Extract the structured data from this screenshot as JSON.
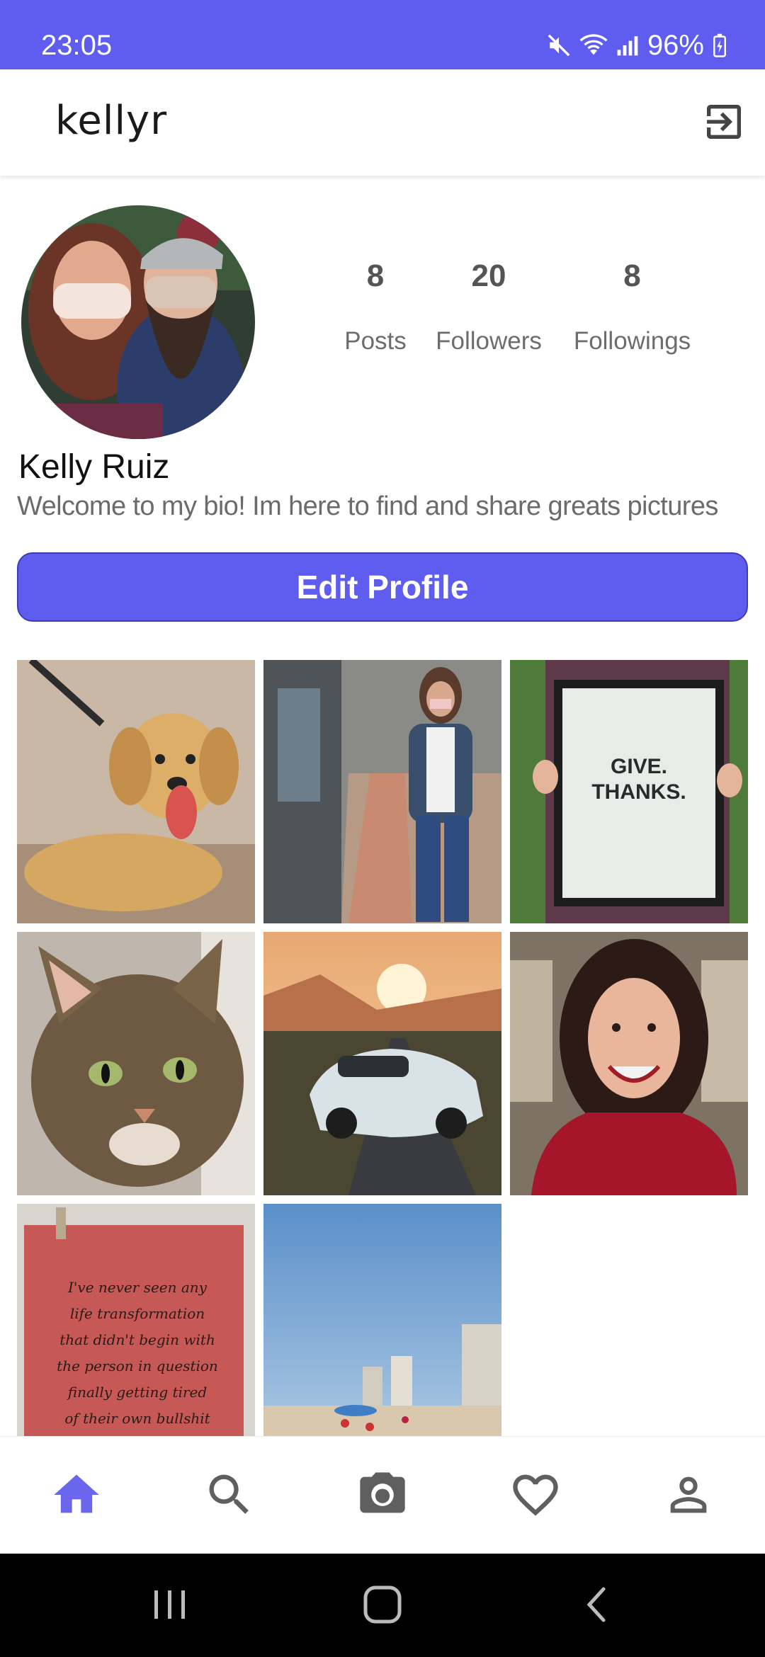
{
  "status_bar": {
    "time": "23:05",
    "battery": "96%",
    "icons": [
      "mute-icon",
      "wifi-icon",
      "signal-icon",
      "battery-charging-icon"
    ]
  },
  "app_bar": {
    "title": "kellyr",
    "logout_icon": "logout-icon"
  },
  "profile": {
    "name": "Kelly Ruiz",
    "bio": "Welcome to my bio! Im here to find and share greats pictures",
    "stats": [
      {
        "value": "8",
        "label": "Posts"
      },
      {
        "value": "20",
        "label": "Followers"
      },
      {
        "value": "8",
        "label": "Followings"
      }
    ],
    "edit_button": "Edit Profile"
  },
  "posts": [
    {
      "subject": "golden retriever puppy"
    },
    {
      "subject": "woman running with mask"
    },
    {
      "subject": "sign",
      "sign_text": [
        "GIVE.",
        "THANKS."
      ]
    },
    {
      "subject": "tabby cat"
    },
    {
      "subject": "white sports car at sunset"
    },
    {
      "subject": "smiling woman red sweater"
    },
    {
      "subject": "handwritten quote",
      "quote_lines": [
        "I've never seen any",
        "life transformation",
        "that didn't begin with",
        "the person in question",
        "finally getting tired",
        "of their own bullshit"
      ]
    },
    {
      "subject": "beach with buildings"
    }
  ],
  "bottom_nav": {
    "items": [
      "home-icon",
      "search-icon",
      "camera-icon",
      "heart-icon",
      "profile-icon"
    ],
    "active": "home-icon",
    "active_color": "#6a67ee",
    "inactive_color": "#5f5f5f"
  },
  "system_nav": [
    "recents-icon",
    "home-button-icon",
    "back-icon"
  ],
  "colors": {
    "accent": "#5f5cf0"
  }
}
